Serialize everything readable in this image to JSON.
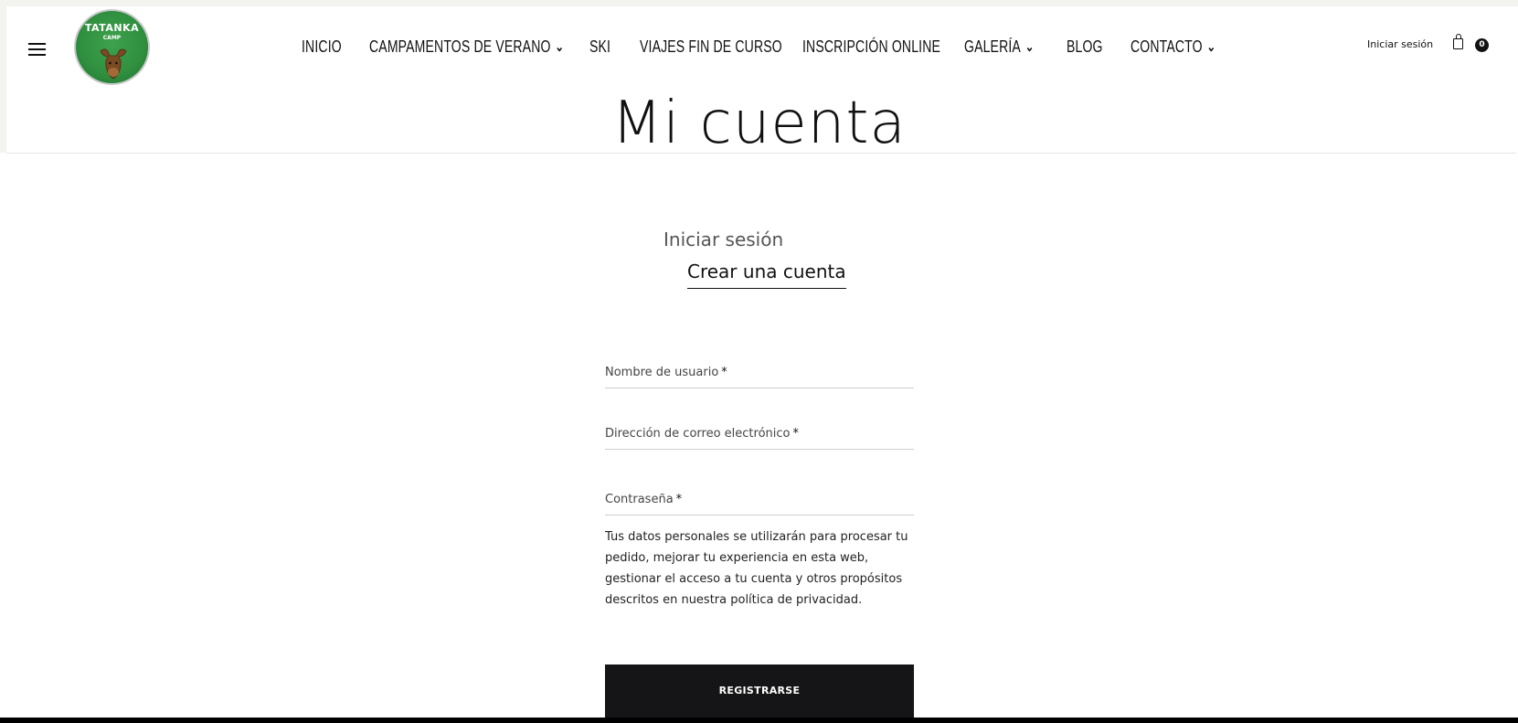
{
  "header": {
    "logo_text": "TATANKA",
    "logo_sub": "CAMP",
    "nav": [
      {
        "label": "INICIO",
        "has_dropdown": false
      },
      {
        "label": "CAMPAMENTOS DE VERANO",
        "has_dropdown": true
      },
      {
        "label": "SKI",
        "has_dropdown": false
      },
      {
        "label": "VIAJES FIN DE CURSO",
        "has_dropdown": false
      },
      {
        "label": "INSCRIPCIÓN ONLINE",
        "has_dropdown": false
      },
      {
        "label": "GALERÍA",
        "has_dropdown": true
      },
      {
        "label": "BLOG",
        "has_dropdown": false
      },
      {
        "label": "CONTACTO",
        "has_dropdown": true
      }
    ],
    "login_link": "Iniciar sesión",
    "cart_count": "0"
  },
  "main": {
    "title": "Mi cuenta",
    "tabs": {
      "login": "Iniciar sesión",
      "register": "Crear una cuenta"
    },
    "form": {
      "username_label": "Nombre de usuario",
      "email_label": "Dirección de correo electrónico",
      "password_label": "Contraseña",
      "required_mark": "*",
      "privacy_text": "Tus datos personales se utilizarán para procesar tu pedido, mejorar tu experiencia en esta web, gestionar el acceso a tu cuenta y otros propósitos descritos en nuestra política de privacidad.",
      "submit_label": "REGISTRARSE"
    }
  },
  "colors": {
    "button_bg": "#151517",
    "logo_green": "#2f8f3f"
  },
  "icons": {
    "menu": "hamburger-menu-icon",
    "cart": "shopping-bag-icon",
    "dropdown": "chevron-down-icon"
  }
}
